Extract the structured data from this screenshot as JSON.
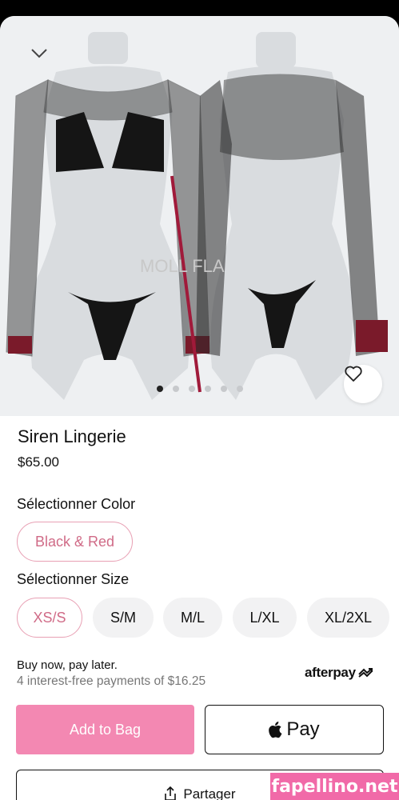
{
  "product": {
    "title": "Siren Lingerie",
    "price": "$65.00",
    "gallery": {
      "image_count": 6,
      "active_index": 0,
      "watermark_text": "MOLL FLA"
    }
  },
  "color_option": {
    "label": "Sélectionner Color",
    "choices": [
      "Black & Red"
    ],
    "selected": "Black & Red"
  },
  "size_option": {
    "label": "Sélectionner Size",
    "choices": [
      "XS/S",
      "S/M",
      "M/L",
      "L/XL",
      "XL/2XL"
    ],
    "selected": "XS/S"
  },
  "bnpl": {
    "headline": "Buy now, pay later.",
    "detail": "4 interest-free payments of $16.25",
    "provider": "afterpay"
  },
  "actions": {
    "add_to_bag": "Add to Bag",
    "apple_pay": "Pay",
    "share": "Partager"
  },
  "site_watermark": "fapellino.net",
  "colors": {
    "accent_pink": "#f388b2",
    "selected_border": "#e8a0b4",
    "selected_text": "#d06b87"
  },
  "icons": [
    "chevron-down-icon",
    "heart-icon",
    "apple-icon",
    "share-icon",
    "afterpay-logo-icon"
  ]
}
